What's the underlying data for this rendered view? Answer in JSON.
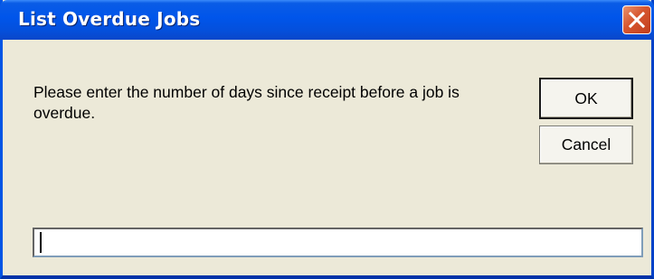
{
  "window": {
    "title": "List Overdue Jobs",
    "close_icon": "close-icon"
  },
  "dialog": {
    "message": "Please enter the number of days since receipt before a job is overdue.",
    "ok_label": "OK",
    "cancel_label": "Cancel",
    "input_value": ""
  },
  "colors": {
    "titlebar": "#0055ea",
    "window_background": "#ece9d8",
    "close_button": "#d6562f"
  }
}
